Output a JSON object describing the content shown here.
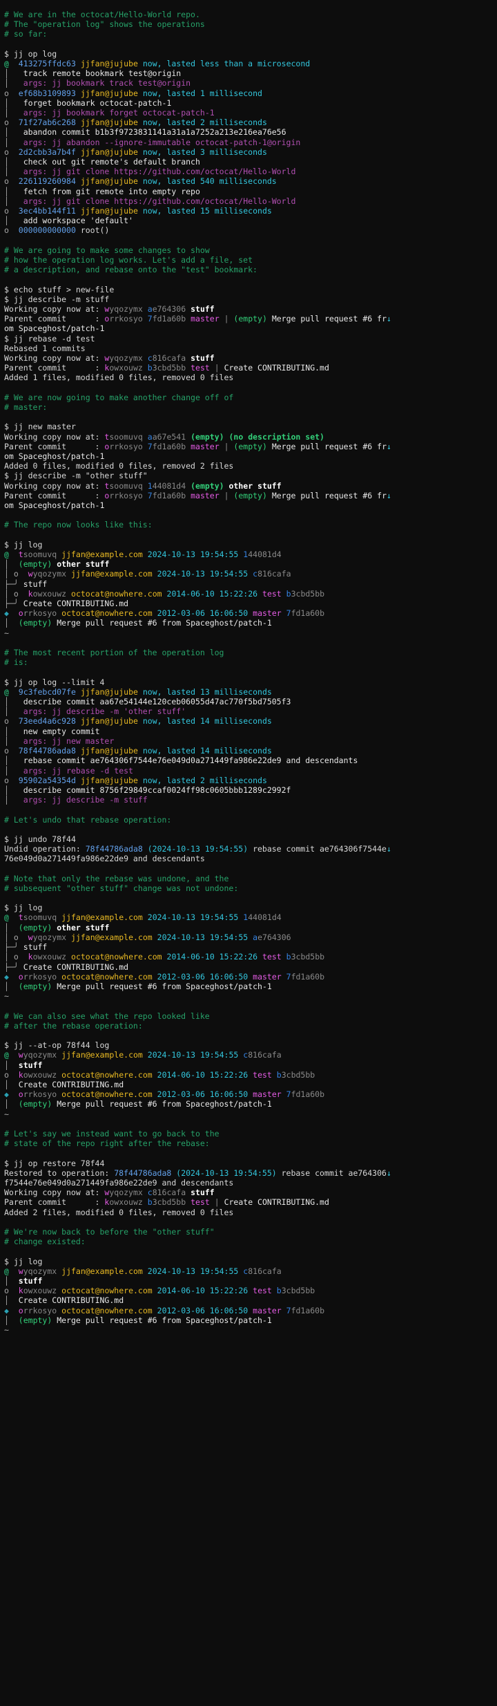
{
  "terminal": {
    "prompt": "$",
    "colors": {
      "background": "#0d0d0d",
      "foreground": "#d8d8d8",
      "comment_green": "#26a269",
      "command_arg_magenta": "#b14fb1",
      "op_id_blue": "#3584e4",
      "user_yellow": "#c9a227",
      "timestamp_cyan": "#2aa1b3",
      "change_id_magenta": "#b14fb1",
      "bookmark_magenta": "#b14fb1",
      "empty_green": "#33d17a",
      "immutable_cyan": "#33c7de"
    },
    "graph_glyphs": {
      "working_copy": "@",
      "node": "o",
      "immutable_node": "◆",
      "vertical": "│",
      "elided": "~",
      "merge_left": "├─╯",
      "wrap_marker": "↓"
    }
  },
  "sections": [
    {
      "id": "intro-comment",
      "comments": [
        "# We are in the octocat/Hello-World repo.",
        "# The \"operation log\" shows the operations",
        "# so far:"
      ]
    },
    {
      "id": "op-log-1",
      "command": "jj op log",
      "operations": [
        {
          "marker": "@",
          "id": "413275ffdc63",
          "user": "jjfan@jujube",
          "time": "now, lasted less than a microsecond",
          "description": "track remote bookmark test@origin",
          "args": "args: jj bookmark track test@origin"
        },
        {
          "marker": "o",
          "id": "ef68b3109893",
          "user": "jjfan@jujube",
          "time": "now, lasted 1 millisecond",
          "description": "forget bookmark octocat-patch-1",
          "args": "args: jj bookmark forget octocat-patch-1"
        },
        {
          "marker": "o",
          "id": "71f27ab6c268",
          "user": "jjfan@jujube",
          "time": "now, lasted 2 milliseconds",
          "description": "abandon commit b1b3f9723831141a31a1a7252a213e216ea76e56",
          "args": "args: jj abandon --ignore-immutable octocat-patch-1@origin"
        },
        {
          "marker": "o",
          "id": "2d2cbb3a7b4f",
          "user": "jjfan@jujube",
          "time": "now, lasted 3 milliseconds",
          "description": "check out git remote's default branch",
          "args": "args: jj git clone https://github.com/octocat/Hello-World"
        },
        {
          "marker": "o",
          "id": "226119260984",
          "user": "jjfan@jujube",
          "time": "now, lasted 540 milliseconds",
          "description": "fetch from git remote into empty repo",
          "args": "args: jj git clone https://github.com/octocat/Hello-World"
        },
        {
          "marker": "o",
          "id": "3ec4bb144f11",
          "user": "jjfan@jujube",
          "time": "now, lasted 15 milliseconds",
          "description": "add workspace 'default'",
          "args": ""
        },
        {
          "marker": "o",
          "id": "000000000000",
          "user": "",
          "time": "",
          "description": "root()",
          "args": ""
        }
      ]
    },
    {
      "id": "changes-comment",
      "comments": [
        "# We are going to make some changes to show",
        "# how the operation log works. Let's add a file, set",
        "# a description, and rebase onto the \"test\" bookmark:"
      ]
    },
    {
      "id": "echo-describe-rebase",
      "commands": [
        "echo stuff > new-file",
        "jj describe -m stuff",
        "jj rebase -d test"
      ],
      "describe_output": {
        "working_copy_label": "Working copy now at: ",
        "working_copy_change_id": "wyqozymx",
        "working_copy_commit_id": "ae764306",
        "working_copy_desc": "stuff",
        "parent_label": "Parent commit      : ",
        "parent_change_id": "orrkosyo",
        "parent_commit_id": "7fd1a60b",
        "parent_bookmark": "master",
        "parent_empty": "(empty)",
        "parent_desc_line1": "Merge pull request #6 fr",
        "parent_desc_line2": "om Spaceghost/patch-1"
      },
      "rebase_output": {
        "rebased": "Rebased 1 commits",
        "working_copy_label": "Working copy now at: ",
        "working_copy_change_id": "wyqozymx",
        "working_copy_commit_id": "c816cafa",
        "working_copy_desc": "stuff",
        "parent_label": "Parent commit      : ",
        "parent_change_id": "kowxouwz",
        "parent_commit_id": "b3cbd5bb",
        "parent_bookmark": "test",
        "parent_desc": "Create CONTRIBUTING.md",
        "stats": "Added 1 files, modified 0 files, removed 0 files"
      }
    },
    {
      "id": "another-change-comment",
      "comments": [
        "# We are now going to make another change off of",
        "# master:"
      ]
    },
    {
      "id": "new-master",
      "commands": [
        "jj new master",
        "jj describe -m \"other stuff\""
      ],
      "new_output": {
        "working_copy_label": "Working copy now at: ",
        "working_copy_change_id": "tsoomuvq",
        "working_copy_commit_id": "aa67e541",
        "working_copy_empty": "(empty)",
        "working_copy_desc": "(no description set)",
        "parent_label": "Parent commit      : ",
        "parent_change_id": "orrkosyo",
        "parent_commit_id": "7fd1a60b",
        "parent_bookmark": "master",
        "parent_empty": "(empty)",
        "parent_desc_line1": "Merge pull request #6 fr",
        "parent_desc_line2": "om Spaceghost/patch-1",
        "stats": "Added 0 files, modified 0 files, removed 2 files"
      },
      "describe_output": {
        "working_copy_label": "Working copy now at: ",
        "working_copy_change_id": "tsoomuvq",
        "working_copy_commit_id": "144081d4",
        "working_copy_empty": "(empty)",
        "working_copy_desc": "other stuff",
        "parent_label": "Parent commit      : ",
        "parent_change_id": "orrkosyo",
        "parent_commit_id": "7fd1a60b",
        "parent_bookmark": "master",
        "parent_empty": "(empty)",
        "parent_desc_line1": "Merge pull request #6 fr",
        "parent_desc_line2": "om Spaceghost/patch-1"
      }
    },
    {
      "id": "repo-looks-comment",
      "comments": [
        "# The repo now looks like this:"
      ]
    },
    {
      "id": "log-1",
      "command": "jj log",
      "commits": [
        {
          "change_id_head": "t",
          "change_id_rest": "soomuvq",
          "author": "jjfan@example.com",
          "date": "2024-10-13 19:54:55",
          "bookmark": "",
          "commit_id_head": "1",
          "commit_id_rest": "44081d4",
          "empty": "(empty)",
          "desc": "other stuff"
        },
        {
          "change_id_head": "w",
          "change_id_rest": "yqozymx",
          "author": "jjfan@example.com",
          "date": "2024-10-13 19:54:55",
          "bookmark": "",
          "commit_id_head": "c",
          "commit_id_rest": "816cafa",
          "empty": "",
          "desc": "stuff"
        },
        {
          "change_id_head": "k",
          "change_id_rest": "owxouwz",
          "author": "octocat@nowhere.com",
          "date": "2014-06-10 15:22:26",
          "bookmark": "test",
          "commit_id_head": "b",
          "commit_id_rest": "3cbd5bb",
          "empty": "",
          "desc": "Create CONTRIBUTING.md"
        },
        {
          "change_id_head": "o",
          "change_id_rest": "rrkosyo",
          "author": "octocat@nowhere.com",
          "date": "2012-03-06 16:06:50",
          "bookmark": "master",
          "commit_id_head": "7",
          "commit_id_rest": "fd1a60b",
          "empty": "(empty)",
          "desc": "Merge pull request #6 from Spaceghost/patch-1"
        }
      ],
      "elided": "~"
    },
    {
      "id": "recent-op-comment",
      "comments": [
        "# The most recent portion of the operation log",
        "# is:"
      ]
    },
    {
      "id": "op-log-2",
      "command": "jj op log --limit 4",
      "operations": [
        {
          "marker": "@",
          "id": "9c3febcd07fe",
          "user": "jjfan@jujube",
          "time": "now, lasted 13 milliseconds",
          "description": "describe commit aa67e54144e120ceb06055d47ac770f5bd7505f3",
          "args": "args: jj describe -m 'other stuff'"
        },
        {
          "marker": "o",
          "id": "73eed4a6c928",
          "user": "jjfan@jujube",
          "time": "now, lasted 14 milliseconds",
          "description": "new empty commit",
          "args": "args: jj new master"
        },
        {
          "marker": "o",
          "id": "78f44786ada8",
          "user": "jjfan@jujube",
          "time": "now, lasted 14 milliseconds",
          "description": "rebase commit ae764306f7544e76e049d0a271449fa986e22de9 and descendants",
          "args": "args: jj rebase -d test"
        },
        {
          "marker": "o",
          "id": "95902a54354d",
          "user": "jjfan@jujube",
          "time": "now, lasted 2 milliseconds",
          "description": "describe commit 8756f29849ccaf0024ff98c0605bbb1289c2992f",
          "args": "args: jj describe -m stuff"
        }
      ]
    },
    {
      "id": "undo-comment",
      "comments": [
        "# Let's undo that rebase operation:"
      ]
    },
    {
      "id": "undo",
      "command": "jj undo 78f44",
      "undid_label": "Undid operation: ",
      "undid_op_id": "78f44786ada8",
      "undid_time": "(2024-10-13 19:54:55)",
      "undid_desc_line1": " rebase commit ae764306f7544e",
      "undid_desc_line2": "76e049d0a271449fa986e22de9 and descendants"
    },
    {
      "id": "note-comment",
      "comments": [
        "# Note that only the rebase was undone, and the",
        "# subsequent \"other stuff\" change was not undone:"
      ]
    },
    {
      "id": "log-2",
      "command": "jj log",
      "commits": [
        {
          "change_id_head": "t",
          "change_id_rest": "soomuvq",
          "author": "jjfan@example.com",
          "date": "2024-10-13 19:54:55",
          "bookmark": "",
          "commit_id_head": "1",
          "commit_id_rest": "44081d4",
          "empty": "(empty)",
          "desc": "other stuff"
        },
        {
          "change_id_head": "w",
          "change_id_rest": "yqozymx",
          "author": "jjfan@example.com",
          "date": "2024-10-13 19:54:55",
          "bookmark": "",
          "commit_id_head": "a",
          "commit_id_rest": "e764306",
          "empty": "",
          "desc": "stuff"
        },
        {
          "change_id_head": "k",
          "change_id_rest": "owxouwz",
          "author": "octocat@nowhere.com",
          "date": "2014-06-10 15:22:26",
          "bookmark": "test",
          "commit_id_head": "b",
          "commit_id_rest": "3cbd5bb",
          "empty": "",
          "desc": "Create CONTRIBUTING.md"
        },
        {
          "change_id_head": "o",
          "change_id_rest": "rrkosyo",
          "author": "octocat@nowhere.com",
          "date": "2012-03-06 16:06:50",
          "bookmark": "master",
          "commit_id_head": "7",
          "commit_id_rest": "fd1a60b",
          "empty": "(empty)",
          "desc": "Merge pull request #6 from Spaceghost/patch-1"
        }
      ],
      "elided": "~"
    },
    {
      "id": "at-op-comment",
      "comments": [
        "# We can also see what the repo looked like",
        "# after the rebase operation:"
      ]
    },
    {
      "id": "log-3",
      "command": "jj --at-op 78f44 log",
      "commits": [
        {
          "change_id_head": "w",
          "change_id_rest": "yqozymx",
          "author": "jjfan@example.com",
          "date": "2024-10-13 19:54:55",
          "bookmark": "",
          "commit_id_head": "c",
          "commit_id_rest": "816cafa",
          "empty": "",
          "desc": "stuff"
        },
        {
          "change_id_head": "k",
          "change_id_rest": "owxouwz",
          "author": "octocat@nowhere.com",
          "date": "2014-06-10 15:22:26",
          "bookmark": "test",
          "commit_id_head": "b",
          "commit_id_rest": "3cbd5bb",
          "empty": "",
          "desc": "Create CONTRIBUTING.md"
        },
        {
          "change_id_head": "o",
          "change_id_rest": "rrkosyo",
          "author": "octocat@nowhere.com",
          "date": "2012-03-06 16:06:50",
          "bookmark": "master",
          "commit_id_head": "7",
          "commit_id_rest": "fd1a60b",
          "empty": "(empty)",
          "desc": "Merge pull request #6 from Spaceghost/patch-1"
        }
      ],
      "elided": "~"
    },
    {
      "id": "restore-comment",
      "comments": [
        "# Let's say we instead want to go back to the",
        "# state of the repo right after the rebase:"
      ]
    },
    {
      "id": "op-restore",
      "command": "jj op restore 78f44",
      "restored_label": "Restored to operation: ",
      "restored_op_id": "78f44786ada8",
      "restored_time": "(2024-10-13 19:54:55)",
      "restored_desc_line1": " rebase commit ae764306",
      "restored_desc_line2": "f7544e76e049d0a271449fa986e22de9 and descendants",
      "working_copy_label": "Working copy now at: ",
      "working_copy_change_id": "wyqozymx",
      "working_copy_commit_id": "c816cafa",
      "working_copy_desc": "stuff",
      "parent_label": "Parent commit      : ",
      "parent_change_id": "kowxouwz",
      "parent_commit_id": "b3cbd5bb",
      "parent_bookmark": "test",
      "parent_desc": "Create CONTRIBUTING.md",
      "stats": "Added 2 files, modified 0 files, removed 0 files"
    },
    {
      "id": "back-comment",
      "comments": [
        "# We're now back to before the \"other stuff\"",
        "# change existed:"
      ]
    },
    {
      "id": "log-4",
      "command": "jj log",
      "commits": [
        {
          "change_id_head": "w",
          "change_id_rest": "yqozymx",
          "author": "jjfan@example.com",
          "date": "2024-10-13 19:54:55",
          "bookmark": "",
          "commit_id_head": "c",
          "commit_id_rest": "816cafa",
          "empty": "",
          "desc": "stuff"
        },
        {
          "change_id_head": "k",
          "change_id_rest": "owxouwz",
          "author": "octocat@nowhere.com",
          "date": "2014-06-10 15:22:26",
          "bookmark": "test",
          "commit_id_head": "b",
          "commit_id_rest": "3cbd5bb",
          "empty": "",
          "desc": "Create CONTRIBUTING.md"
        },
        {
          "change_id_head": "o",
          "change_id_rest": "rrkosyo",
          "author": "octocat@nowhere.com",
          "date": "2012-03-06 16:06:50",
          "bookmark": "master",
          "commit_id_head": "7",
          "commit_id_rest": "fd1a60b",
          "empty": "(empty)",
          "desc": "Merge pull request #6 from Spaceghost/patch-1"
        }
      ],
      "elided": "~"
    }
  ]
}
